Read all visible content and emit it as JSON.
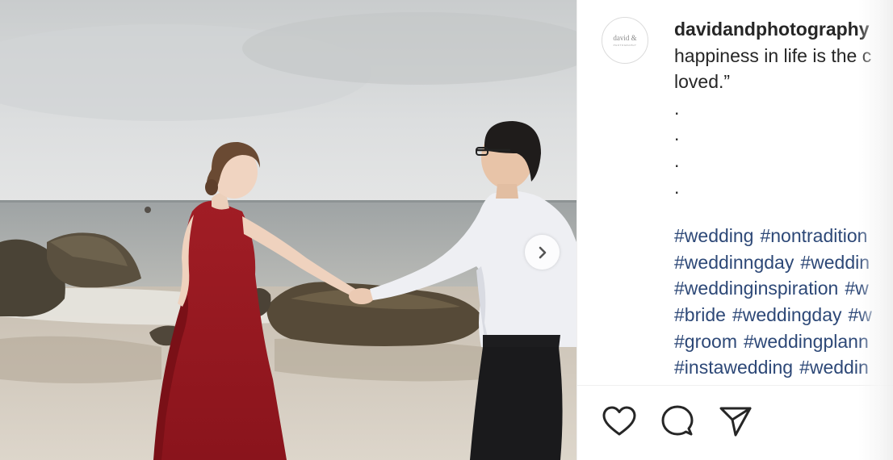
{
  "post": {
    "username": "davidandphotography",
    "avatar_text": "david &",
    "avatar_subtext": "PHOTOGRAPHY",
    "caption_lines": [
      "happiness in life is the c",
      "loved.”",
      ".",
      ".",
      ".",
      "."
    ],
    "hashtag_lines": [
      [
        "#wedding",
        "#nontradition"
      ],
      [
        "#weddinngday",
        "#weddin"
      ],
      [
        "#weddinginspiration",
        "#w"
      ],
      [
        "#bride",
        "#weddingday",
        "#w"
      ],
      [
        "#groom",
        "#weddingplann"
      ],
      [
        "#instawedding",
        "#weddin"
      ]
    ]
  },
  "photo": {
    "alt": "couple holding hands on beach",
    "next_icon": "chevron-right-icon"
  },
  "actions": {
    "like_icon": "heart-icon",
    "comment_icon": "comment-icon",
    "share_icon": "paper-plane-icon"
  },
  "colors": {
    "hashtag": "#2d4877",
    "text": "#262626",
    "dress": "#9e1a22"
  }
}
